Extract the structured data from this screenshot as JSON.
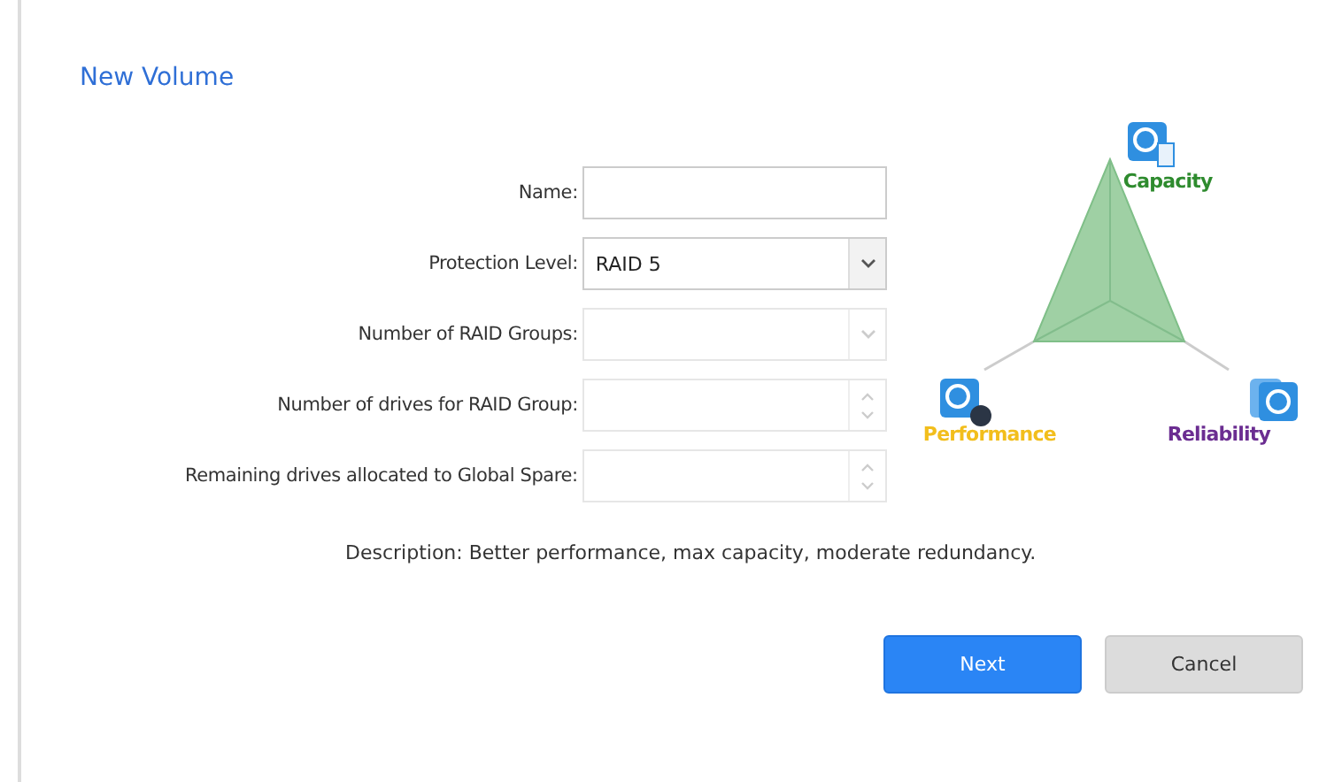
{
  "title": "New Volume",
  "fields": [
    {
      "label": "Name:",
      "kind": "text",
      "disabled": false
    },
    {
      "label": "Protection Level:",
      "kind": "select",
      "value": "RAID 5",
      "disabled": false
    },
    {
      "label": "Number of RAID Groups:",
      "kind": "select",
      "disabled": true
    },
    {
      "label": "Number of drives for RAID Group:",
      "kind": "spinner",
      "disabled": true
    },
    {
      "label": "Remaining drives allocated to Global Spare:",
      "kind": "spinner",
      "disabled": true
    }
  ],
  "radar": {
    "axes": [
      {
        "label": "Capacity",
        "color": "#2e8b2e"
      },
      {
        "label": "Performance",
        "color": "#f2be1c"
      },
      {
        "label": "Reliability",
        "color": "#6b2d91"
      }
    ]
  },
  "description": "Description: Better performance, max capacity, moderate redundancy.",
  "buttons": [
    {
      "label": "Next",
      "kind": "primary"
    },
    {
      "label": "Cancel",
      "kind": "secondary"
    }
  ]
}
